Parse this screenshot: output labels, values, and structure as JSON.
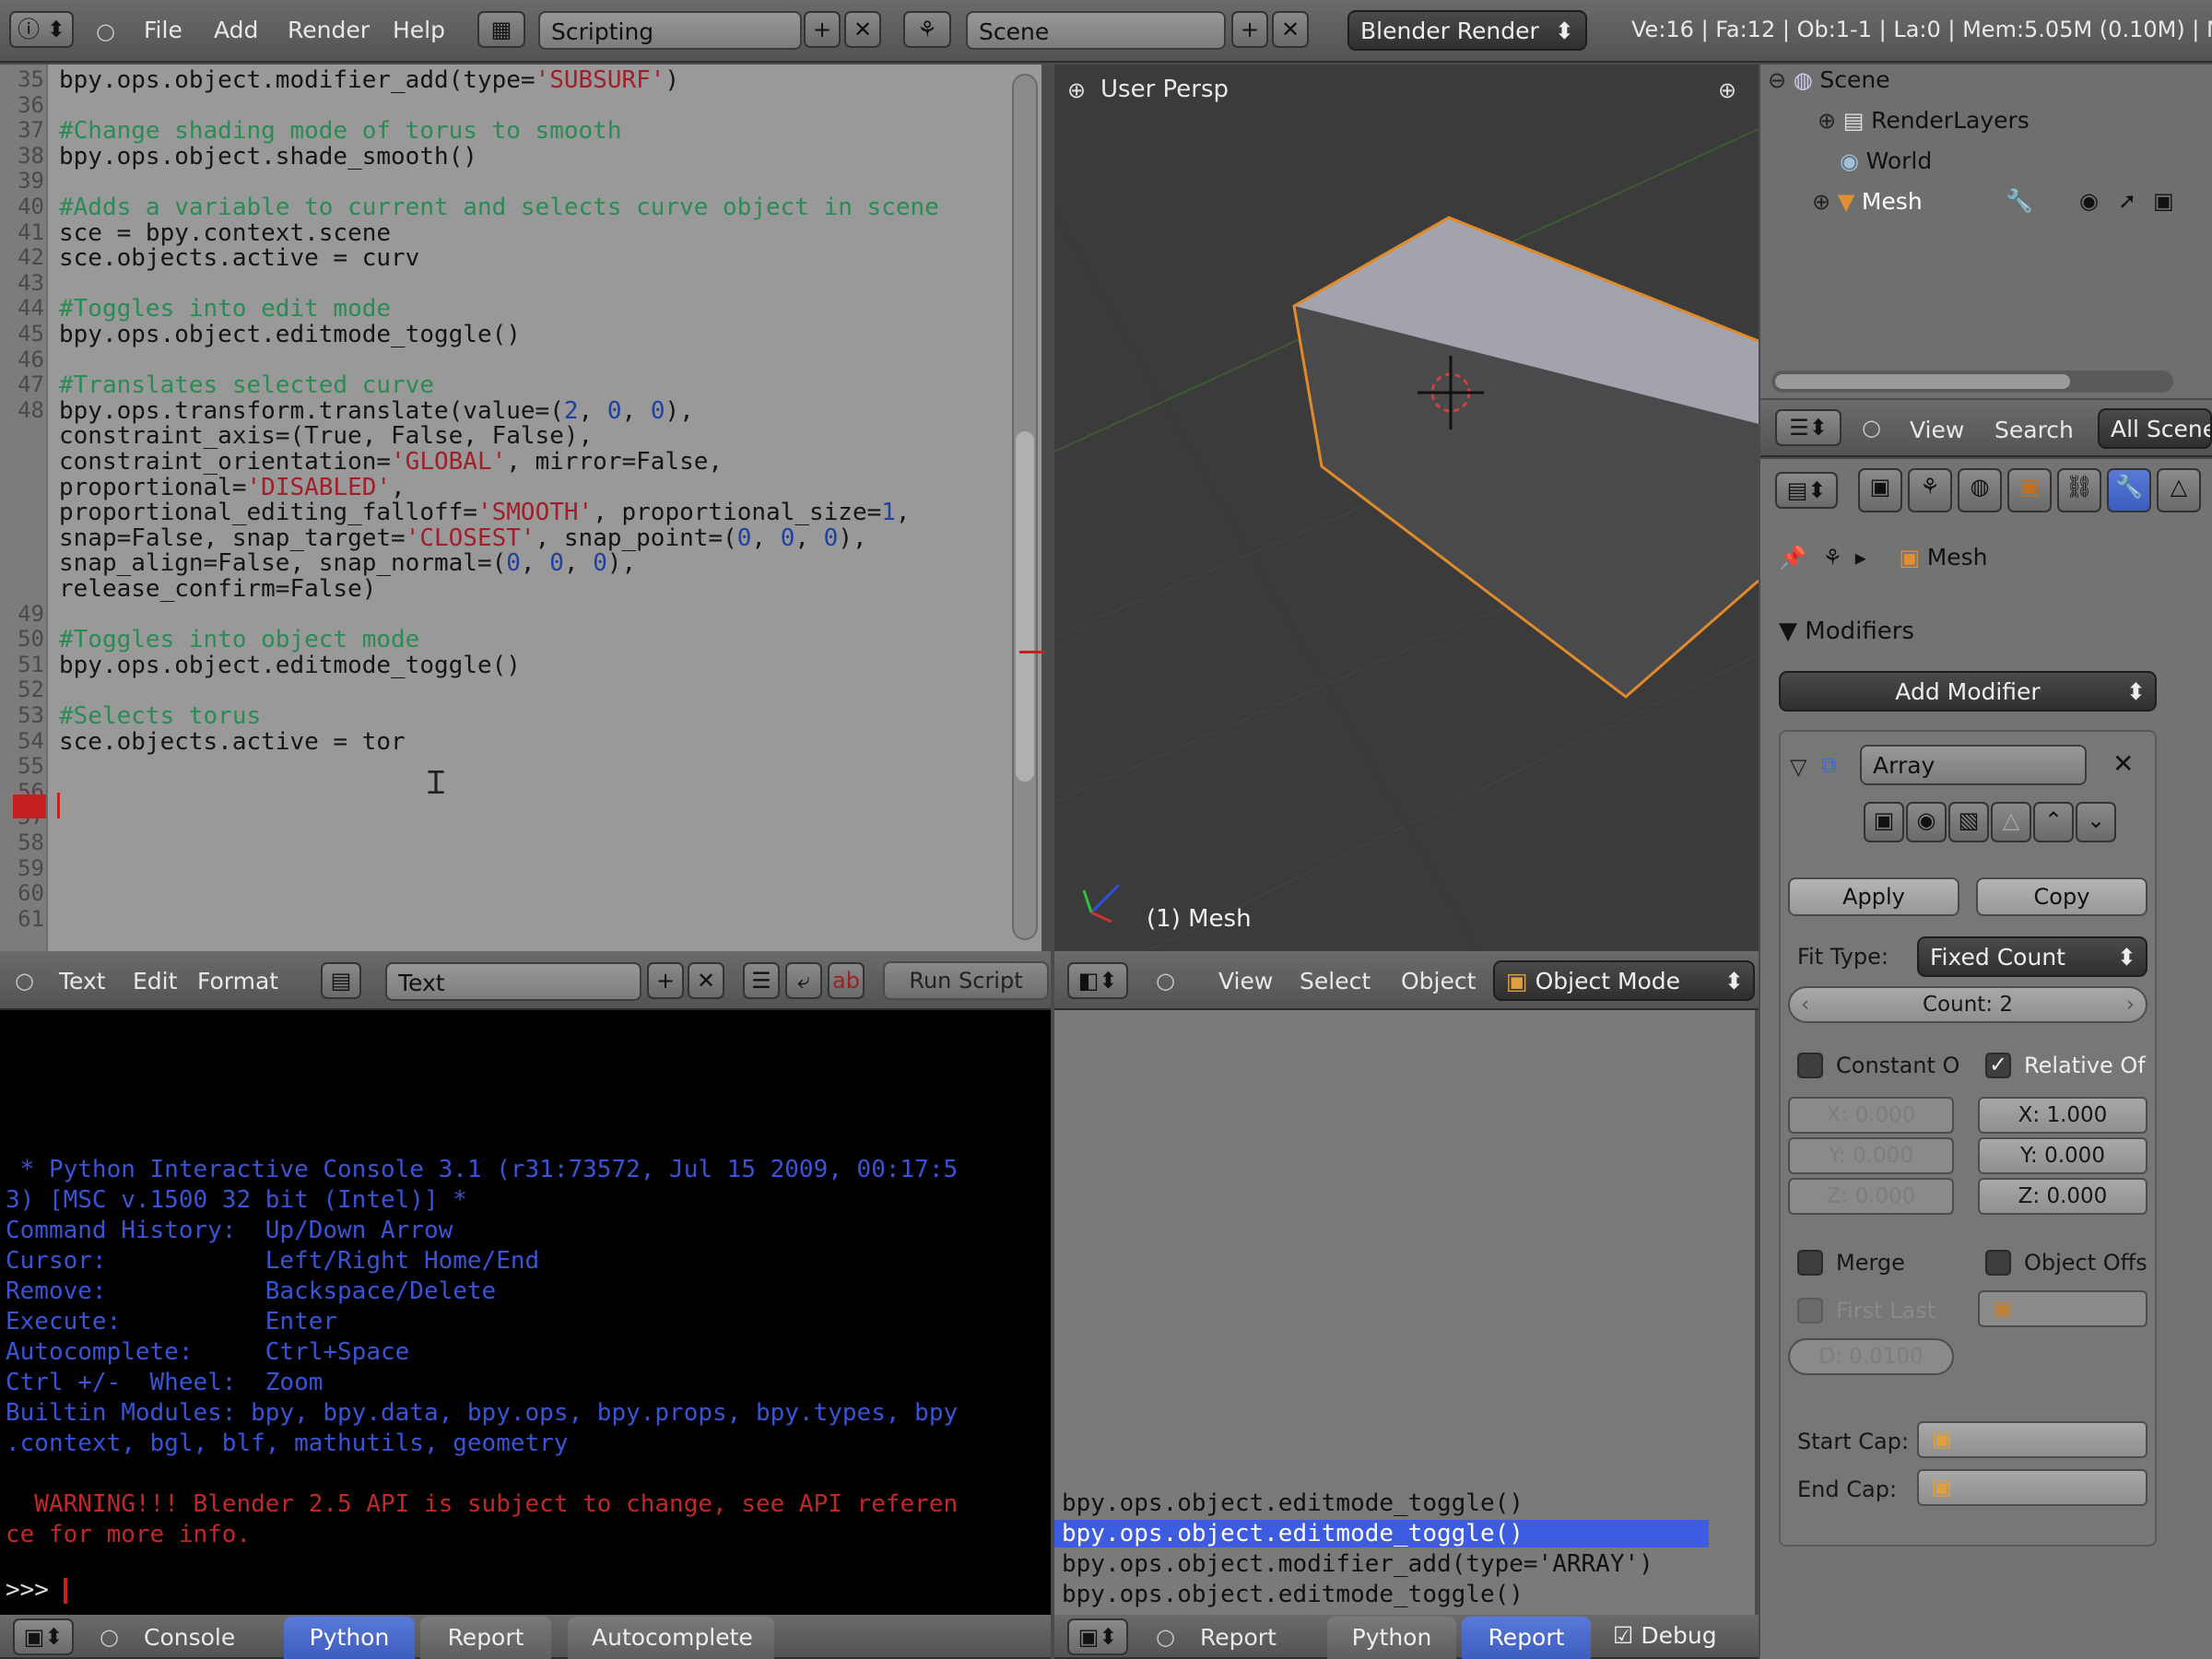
{
  "topbar": {
    "menu": [
      "File",
      "Add",
      "Render",
      "Help"
    ],
    "screen_name": "Scripting",
    "scene_name": "Scene",
    "engine": "Blender Render",
    "stats": "Ve:16 | Fa:12 | Ob:1-1 | La:0 | Mem:5.05M (0.10M) | M"
  },
  "editor": {
    "lines": [
      {
        "n": "35",
        "parts": [
          [
            "t",
            "bpy.ops.object.modifier_add(type="
          ],
          [
            "s",
            "'SUBSURF'"
          ],
          [
            "t",
            ")"
          ]
        ]
      },
      {
        "n": "36",
        "parts": []
      },
      {
        "n": "37",
        "parts": [
          [
            "c",
            "#Change shading mode of torus to smooth"
          ]
        ]
      },
      {
        "n": "38",
        "parts": [
          [
            "t",
            "bpy.ops.object.shade_smooth()"
          ]
        ]
      },
      {
        "n": "39",
        "parts": []
      },
      {
        "n": "40",
        "parts": [
          [
            "c",
            "#Adds a variable to current and selects curve object in scene"
          ]
        ]
      },
      {
        "n": "41",
        "parts": [
          [
            "t",
            "sce = bpy.context.scene"
          ]
        ]
      },
      {
        "n": "42",
        "parts": [
          [
            "t",
            "sce.objects.active = curv"
          ]
        ]
      },
      {
        "n": "43",
        "parts": []
      },
      {
        "n": "44",
        "parts": [
          [
            "c",
            "#Toggles into edit mode"
          ]
        ]
      },
      {
        "n": "45",
        "parts": [
          [
            "t",
            "bpy.ops.object.editmode_toggle()"
          ]
        ]
      },
      {
        "n": "46",
        "parts": []
      },
      {
        "n": "47",
        "parts": [
          [
            "c",
            "#Translates selected curve"
          ]
        ]
      },
      {
        "n": "48",
        "parts": [
          [
            "t",
            "bpy.ops.transform.translate(value=("
          ],
          [
            "n",
            "2"
          ],
          [
            "t",
            ", "
          ],
          [
            "n",
            "0"
          ],
          [
            "t",
            ", "
          ],
          [
            "n",
            "0"
          ],
          [
            "t",
            "),"
          ]
        ]
      },
      {
        "n": "",
        "parts": [
          [
            "t",
            "constraint_axis=(True, False, False),"
          ]
        ]
      },
      {
        "n": "",
        "parts": [
          [
            "t",
            "constraint_orientation="
          ],
          [
            "s",
            "'GLOBAL'"
          ],
          [
            "t",
            ", mirror=False,"
          ]
        ]
      },
      {
        "n": "",
        "parts": [
          [
            "t",
            "proportional="
          ],
          [
            "s",
            "'DISABLED'"
          ],
          [
            "t",
            ","
          ]
        ]
      },
      {
        "n": "",
        "parts": [
          [
            "t",
            "proportional_editing_falloff="
          ],
          [
            "s",
            "'SMOOTH'"
          ],
          [
            "t",
            ", proportional_size="
          ],
          [
            "n",
            "1"
          ],
          [
            "t",
            ","
          ]
        ]
      },
      {
        "n": "",
        "parts": [
          [
            "t",
            "snap=False, snap_target="
          ],
          [
            "s",
            "'CLOSEST'"
          ],
          [
            "t",
            ", snap_point=("
          ],
          [
            "n",
            "0"
          ],
          [
            "t",
            ", "
          ],
          [
            "n",
            "0"
          ],
          [
            "t",
            ", "
          ],
          [
            "n",
            "0"
          ],
          [
            "t",
            "),"
          ]
        ]
      },
      {
        "n": "",
        "parts": [
          [
            "t",
            "snap_align=False, snap_normal=("
          ],
          [
            "n",
            "0"
          ],
          [
            "t",
            ", "
          ],
          [
            "n",
            "0"
          ],
          [
            "t",
            ", "
          ],
          [
            "n",
            "0"
          ],
          [
            "t",
            "),"
          ]
        ]
      },
      {
        "n": "",
        "parts": [
          [
            "t",
            "release_confirm=False)"
          ]
        ]
      },
      {
        "n": "49",
        "parts": []
      },
      {
        "n": "50",
        "parts": [
          [
            "c",
            "#Toggles into object mode"
          ]
        ]
      },
      {
        "n": "51",
        "parts": [
          [
            "t",
            "bpy.ops.object.editmode_toggle()"
          ]
        ]
      },
      {
        "n": "52",
        "parts": []
      },
      {
        "n": "53",
        "parts": [
          [
            "c",
            "#Selects torus"
          ]
        ]
      },
      {
        "n": "54",
        "parts": [
          [
            "t",
            "sce.objects.active = tor"
          ]
        ]
      },
      {
        "n": "55",
        "parts": []
      },
      {
        "n": "56",
        "parts": []
      },
      {
        "n": "57",
        "parts": []
      },
      {
        "n": "58",
        "parts": []
      },
      {
        "n": "59",
        "parts": []
      },
      {
        "n": "60",
        "parts": []
      },
      {
        "n": "61",
        "parts": []
      }
    ],
    "header": {
      "menu": [
        "Text",
        "Edit",
        "Format"
      ],
      "text_name": "Text",
      "run_label": "Run Script"
    }
  },
  "viewport": {
    "title": "User Persp",
    "object_label": "(1) Mesh",
    "header": {
      "menu": [
        "View",
        "Select",
        "Object"
      ],
      "mode": "Object Mode"
    }
  },
  "console": {
    "lines": [
      {
        "c": "blue",
        "t": " * Python Interactive Console 3.1 (r31:73572, Jul 15 2009, 00:17:5"
      },
      {
        "c": "blue",
        "t": "3) [MSC v.1500 32 bit (Intel)] *"
      },
      {
        "c": "blue",
        "t": "Command History:  Up/Down Arrow"
      },
      {
        "c": "blue",
        "t": "Cursor:           Left/Right Home/End"
      },
      {
        "c": "blue",
        "t": "Remove:           Backspace/Delete"
      },
      {
        "c": "blue",
        "t": "Execute:          Enter"
      },
      {
        "c": "blue",
        "t": "Autocomplete:     Ctrl+Space"
      },
      {
        "c": "blue",
        "t": "Ctrl +/-  Wheel:  Zoom"
      },
      {
        "c": "blue",
        "t": "Builtin Modules: bpy, bpy.data, bpy.ops, bpy.props, bpy.types, bpy"
      },
      {
        "c": "blue",
        "t": ".context, bgl, blf, mathutils, geometry"
      },
      {
        "c": "",
        "t": ""
      },
      {
        "c": "red",
        "t": "  WARNING!!! Blender 2.5 API is subject to change, see API referen"
      },
      {
        "c": "red",
        "t": "ce for more info."
      }
    ],
    "prompt": ">>> ",
    "header": {
      "menu": "Console",
      "tabs": [
        "Python",
        "Report",
        "Autocomplete"
      ]
    }
  },
  "report": {
    "lines": [
      "bpy.ops.object.editmode_toggle()",
      "bpy.ops.object.editmode_toggle()",
      "bpy.ops.object.modifier_add(type='ARRAY')",
      "bpy.ops.object.editmode_toggle()"
    ],
    "selected_index": 1,
    "header": {
      "menu": "Report",
      "tabs": [
        "Python",
        "Report"
      ],
      "debug_label": "Debug"
    }
  },
  "outliner": {
    "items": [
      "Scene",
      "RenderLayers",
      "World",
      "Mesh"
    ],
    "header": {
      "menu": [
        "View",
        "Search"
      ],
      "filter": "All Scenes"
    }
  },
  "properties": {
    "breadcrumb": "Mesh",
    "modifiers_title": "Modifiers",
    "add_modifier": "Add Modifier",
    "modifier_name": "Array",
    "apply_label": "Apply",
    "copy_label": "Copy",
    "fit_type_label": "Fit Type:",
    "fit_type_value": "Fixed Count",
    "count_label": "Count: 2",
    "constant_label": "Constant O",
    "relative_label": "Relative Of",
    "const_x": "X: 0.000",
    "const_y": "Y: 0.000",
    "const_z": "Z: 0.000",
    "rel_x": "X: 1.000",
    "rel_y": "Y: 0.000",
    "rel_z": "Z: 0.000",
    "merge_label": "Merge",
    "object_offset_label": "Object Offs",
    "first_last_label": "First Last",
    "distance_label": "D: 0.0100",
    "start_cap_label": "Start Cap:",
    "end_cap_label": "End Cap:"
  },
  "colors": {
    "selection": "#3e5ce0",
    "comment": "#2a8b54",
    "string": "#a0202a",
    "object_outline": "#e08a2a"
  }
}
